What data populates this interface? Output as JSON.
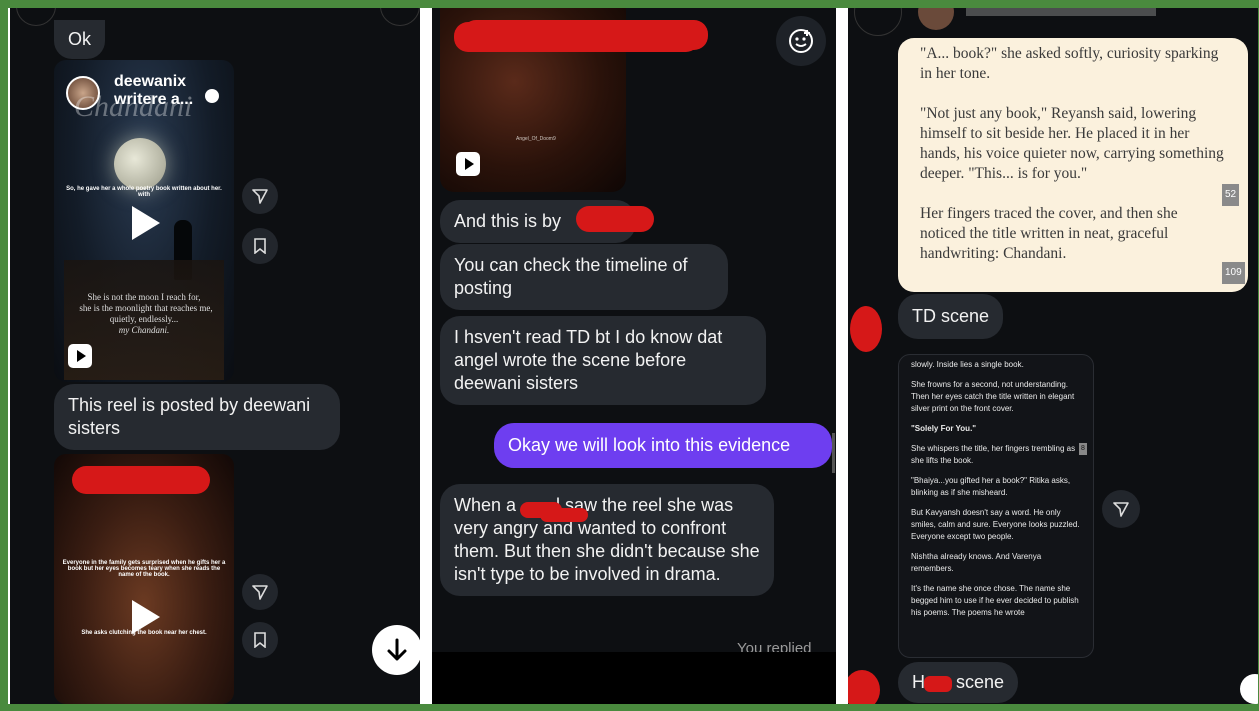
{
  "left": {
    "ok_label": "Ok",
    "reel1": {
      "username": "deewanix",
      "subtitle": "writere a...",
      "watermark": "Chandani",
      "caption_top": "So, he gave her a whole poetry book written about her. with",
      "poem_line1": "She is not the moon I reach for,",
      "poem_line2": "she is the moonlight that reaches me,",
      "poem_line3": "quietly, endlessly...",
      "poem_line4": "my Chandani."
    },
    "message1": "This reel is posted by deewani sisters",
    "reel2": {
      "caption_top": "Everyone in the family gets surprised when he gifts her a book but her eyes becomes teary when she reads the name of the book.",
      "caption_bottom": "She asks clutching the book near her chest."
    }
  },
  "middle": {
    "reel_watermark": "Angel_Of_Doom9",
    "message1": "And this is by",
    "message2": "You can check the timeline of posting",
    "message3": "I hsven't read TD bt I do know dat angel wrote the scene before deewani sisters",
    "sent1": "Okay we will look into this evidence",
    "message4_a": "When a",
    "message4_b": "l saw the reel she was very angry and wanted to confront them. But then she didn't because she isn't type to be involved in drama.",
    "footer": "You replied"
  },
  "right": {
    "story_p1": "\"A... book?\" she asked softly, curiosity sparking in her tone.",
    "story_p2": "\"Not just any book,\" Reyansh said, lowering himself to sit beside her. He placed it in her hands, his voice quieter now, carrying something deeper. \"This... is for you.\"",
    "story_p3": "Her fingers traced the cover, and then she noticed the title written in neat, graceful handwriting: Chandani.",
    "count1": "52",
    "count2": "109",
    "label1": "TD scene",
    "shot": {
      "l1": "slowly. Inside lies a single book.",
      "l2": "She frowns for a second, not understanding. Then her eyes catch the title written in elegant silver print on the front cover.",
      "l3": "\"Solely For You.\"",
      "l4": "She whispers the title, her fingers trembling as she lifts the book.",
      "l5": "\"Bhaiya...you gifted her a book?\" Ritika asks, blinking as if she misheard.",
      "l6": "But Kavyansh doesn't say a word. He only smiles, calm and sure. Everyone looks puzzled. Everyone except two people.",
      "l7": "Nishtha already knows. And Varenya remembers.",
      "l8": "It's the name she once chose. The name she begged him to use if he ever decided to publish his poems. The poems he wrote",
      "count": "8"
    },
    "label2_a": "H",
    "label2_b": " scene"
  },
  "colors": {
    "panel_bg": "#0d0f12",
    "bubble": "#262a30",
    "sent": "#6e3ef0",
    "redact": "#d61818",
    "border": "#4a8a3e",
    "story_bg": "#fbf1dd"
  }
}
